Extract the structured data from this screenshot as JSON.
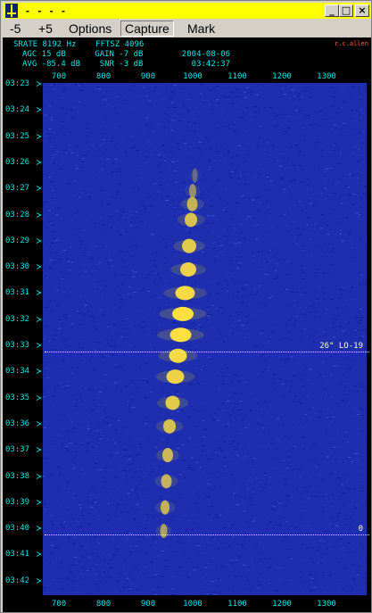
{
  "window": {
    "title": "- - - -",
    "minimize_icon": "minimize-icon",
    "maximize_icon": "maximize-icon",
    "close_icon": "close-icon"
  },
  "menu": [
    {
      "label": "-5",
      "accel": 0
    },
    {
      "label": "+5",
      "accel": 0
    },
    {
      "label": "Options",
      "accel": 0
    },
    {
      "label": "Capture",
      "accel": 0
    },
    {
      "label": "Mark",
      "accel": 0
    }
  ],
  "info": {
    "line1": "SRATE 8192 Hz    FFTSZ 4096",
    "line2": "AGC 15 dB      GAIN -7 dB        2004-08-06",
    "line3": "AVG -85.4 dB    SNR -3 dB          03:42:37",
    "credit": "r.c.allen"
  },
  "freq_axis": [
    "700",
    "800",
    "900",
    "1000",
    "1100",
    "1200",
    "1300"
  ],
  "time_axis": [
    "03:23",
    "03:24",
    "03:25",
    "03:26",
    "03:27",
    "03:28",
    "03:29",
    "03:30",
    "03:31",
    "03:32",
    "03:33",
    "03:34",
    "03:35",
    "03:36",
    "03:37",
    "03:38",
    "03:39",
    "03:40",
    "03:41",
    "03:42"
  ],
  "markers": [
    {
      "label": "26° LO-19",
      "time": "03:33"
    },
    {
      "label": "0",
      "time": "03:40"
    }
  ],
  "colors": {
    "titlebar": "#ffff00",
    "background": "#1e2eae",
    "axis_text": "#00e8e8",
    "signal": "#ffe040"
  },
  "signal_trace": [
    {
      "time_min": 3.5,
      "freq_hz": 1005,
      "width_hz": 6,
      "intensity": 0.3
    },
    {
      "time_min": 4.1,
      "freq_hz": 1000,
      "width_hz": 8,
      "intensity": 0.5
    },
    {
      "time_min": 4.6,
      "freq_hz": 999,
      "width_hz": 12,
      "intensity": 0.7
    },
    {
      "time_min": 5.2,
      "freq_hz": 996,
      "width_hz": 14,
      "intensity": 0.8
    },
    {
      "time_min": 6.2,
      "freq_hz": 992,
      "width_hz": 16,
      "intensity": 0.85
    },
    {
      "time_min": 7.1,
      "freq_hz": 990,
      "width_hz": 18,
      "intensity": 0.9
    },
    {
      "time_min": 8.0,
      "freq_hz": 983,
      "width_hz": 22,
      "intensity": 0.95
    },
    {
      "time_min": 8.8,
      "freq_hz": 978,
      "width_hz": 24,
      "intensity": 1.0
    },
    {
      "time_min": 9.6,
      "freq_hz": 973,
      "width_hz": 24,
      "intensity": 1.0
    },
    {
      "time_min": 10.4,
      "freq_hz": 967,
      "width_hz": 20,
      "intensity": 0.95
    },
    {
      "time_min": 11.2,
      "freq_hz": 961,
      "width_hz": 20,
      "intensity": 0.9
    },
    {
      "time_min": 12.2,
      "freq_hz": 955,
      "width_hz": 16,
      "intensity": 0.85
    },
    {
      "time_min": 13.1,
      "freq_hz": 948,
      "width_hz": 14,
      "intensity": 0.8
    },
    {
      "time_min": 14.2,
      "freq_hz": 944,
      "width_hz": 12,
      "intensity": 0.75
    },
    {
      "time_min": 15.2,
      "freq_hz": 941,
      "width_hz": 12,
      "intensity": 0.7
    },
    {
      "time_min": 16.2,
      "freq_hz": 938,
      "width_hz": 10,
      "intensity": 0.7
    },
    {
      "time_min": 17.1,
      "freq_hz": 935,
      "width_hz": 8,
      "intensity": 0.6
    }
  ]
}
